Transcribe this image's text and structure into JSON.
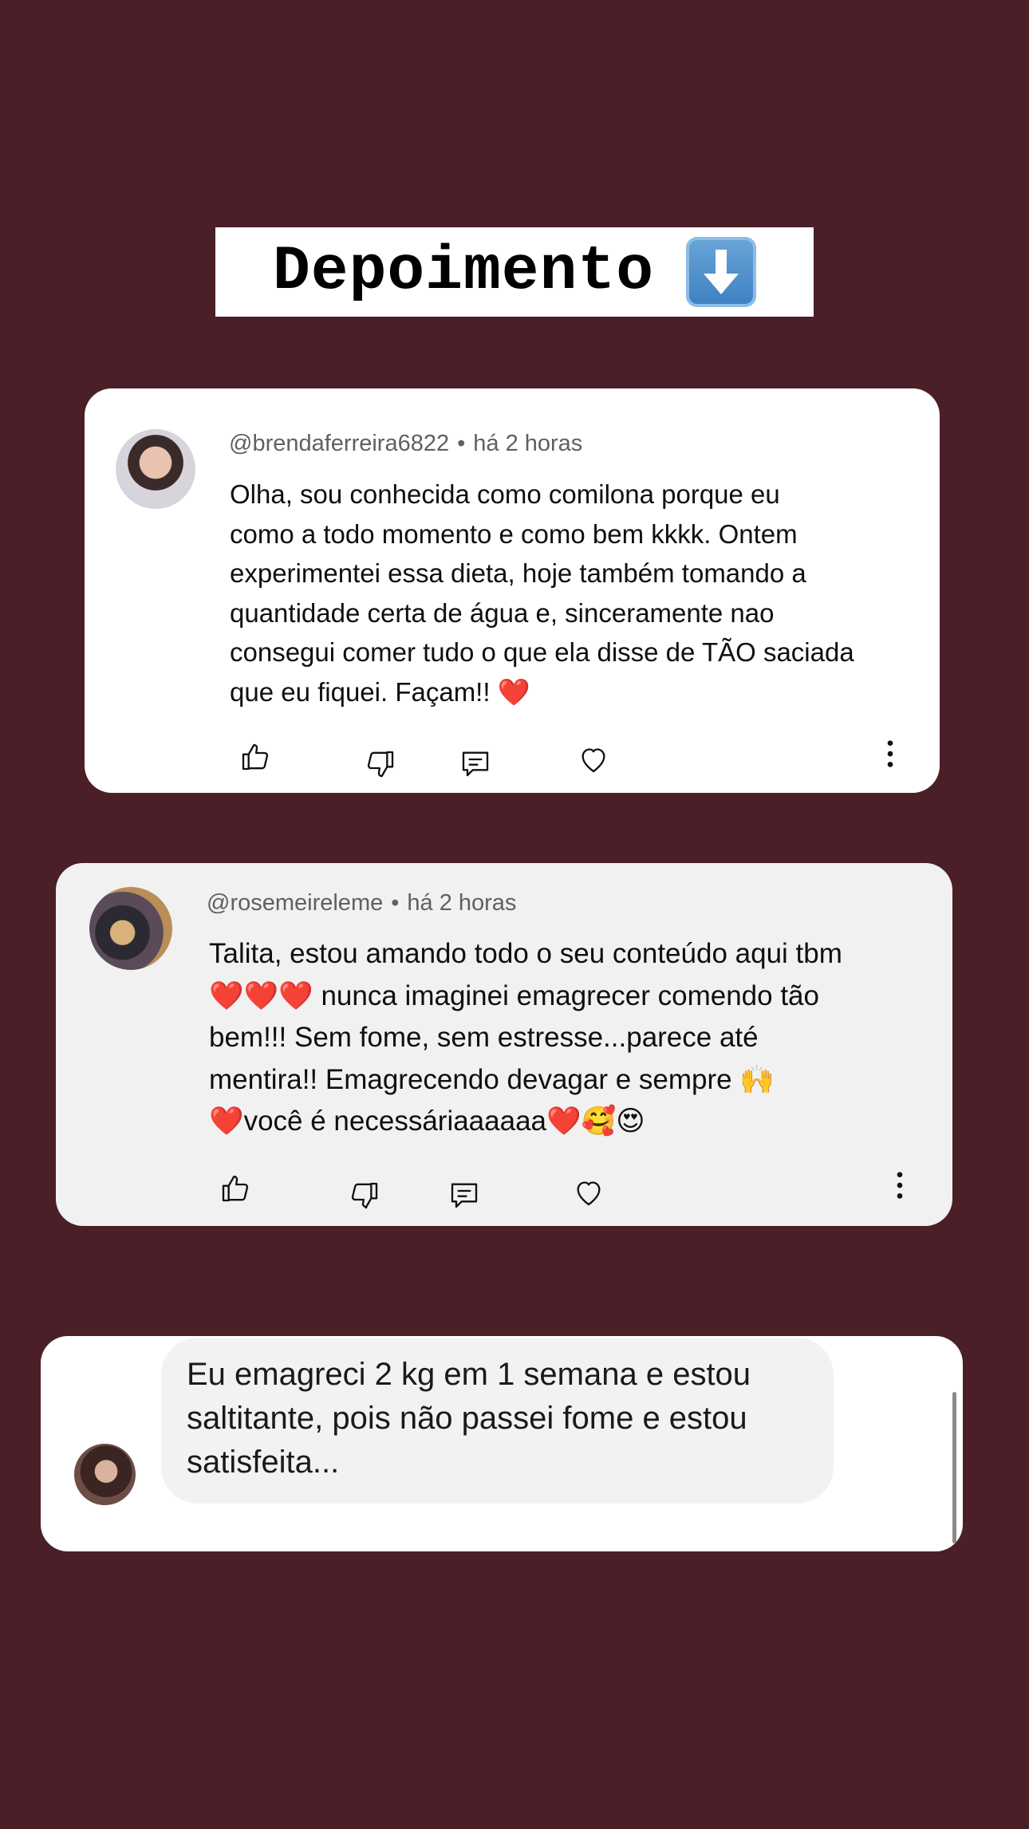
{
  "header": {
    "title": "Depoimento",
    "arrow_icon": "down-arrow-button-emoji"
  },
  "comments": [
    {
      "username": "@brendaferreira6822",
      "separator": "•",
      "time": "há 2 horas",
      "text": "Olha, sou conhecida como comilona porque eu\ncomo a todo momento e como bem kkkk. Ontem\nexperimentei essa dieta, hoje também tomando a\nquantidade certa de água e, sinceramente nao\nconsegui comer tudo o que ela disse de TÃO saciada\nque eu fiquei. Façam!! ❤️"
    },
    {
      "username": "@rosemeireleme",
      "separator": "•",
      "time": "há 2 horas",
      "text": "Talita, estou amando todo o seu conteúdo aqui tbm\n❤️❤️❤️ nunca imaginei emagrecer comendo tão\nbem!!! Sem fome, sem estresse...parece até\nmentira!! Emagrecendo devagar e sempre 🙌\n❤️você é necessáriaaaaaa❤️🥰😍"
    }
  ],
  "reply": {
    "text": "Eu emagreci 2 kg em 1 semana e estou\nsaltitante, pois não passei fome e estou\nsatisfeita..."
  },
  "colors": {
    "background": "#4a1f28",
    "card": "#ffffff",
    "card_alt": "#f1f1f2",
    "text": "#0f0f0f",
    "meta": "#606060"
  }
}
